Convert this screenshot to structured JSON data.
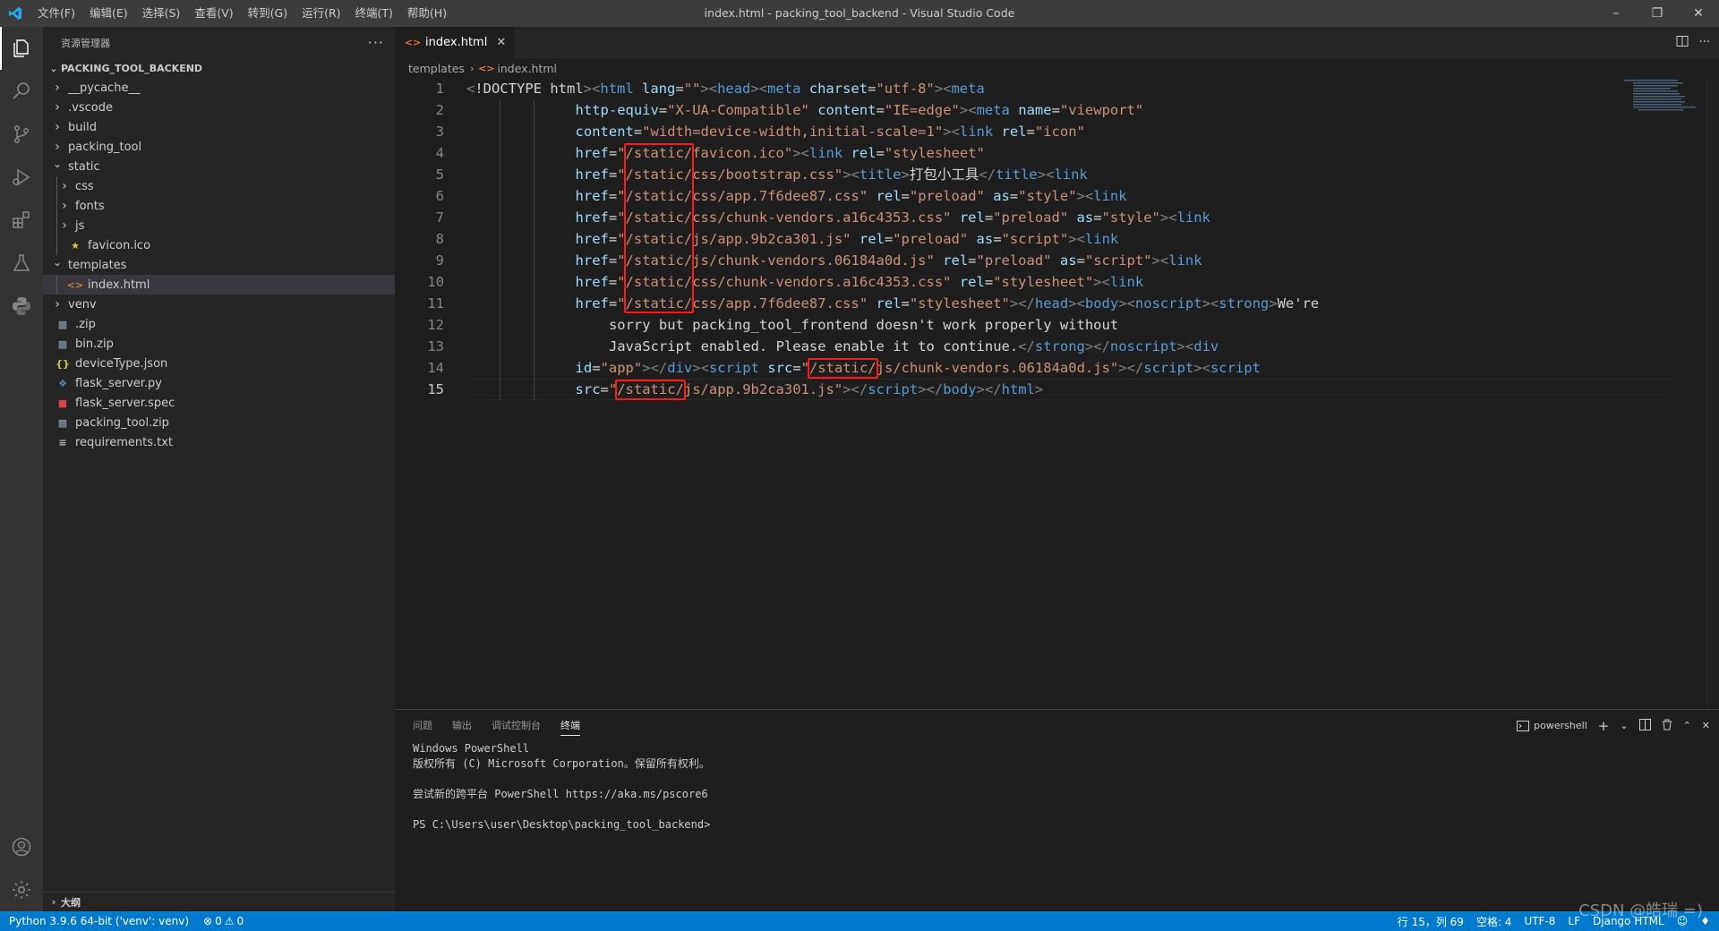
{
  "titlebar": {
    "menu": [
      "文件(F)",
      "编辑(E)",
      "选择(S)",
      "查看(V)",
      "转到(G)",
      "运行(R)",
      "终端(T)",
      "帮助(H)"
    ],
    "title": "index.html - packing_tool_backend - Visual Studio Code"
  },
  "activitybar": {
    "items": [
      "explorer-icon",
      "search-icon",
      "source-control-icon",
      "run-debug-icon",
      "extensions-icon",
      "testing-icon",
      "python-icon"
    ],
    "bottom": [
      "account-icon",
      "settings-gear-icon"
    ]
  },
  "sidebar": {
    "header": "资源管理器",
    "section": "PACKING_TOOL_BACKEND",
    "tree": [
      {
        "label": "__pycache__",
        "type": "folder",
        "depth": 1,
        "open": false
      },
      {
        "label": ".vscode",
        "type": "folder",
        "depth": 1,
        "open": false
      },
      {
        "label": "build",
        "type": "folder",
        "depth": 1,
        "open": false
      },
      {
        "label": "packing_tool",
        "type": "folder",
        "depth": 1,
        "open": false
      },
      {
        "label": "static",
        "type": "folder",
        "depth": 1,
        "open": true
      },
      {
        "label": "css",
        "type": "folder",
        "depth": 2,
        "open": false
      },
      {
        "label": "fonts",
        "type": "folder",
        "depth": 2,
        "open": false
      },
      {
        "label": "js",
        "type": "folder",
        "depth": 2,
        "open": false
      },
      {
        "label": "favicon.ico",
        "type": "file",
        "depth": 2,
        "icon": "star"
      },
      {
        "label": "templates",
        "type": "folder",
        "depth": 1,
        "open": true
      },
      {
        "label": "index.html",
        "type": "file",
        "depth": 2,
        "icon": "html",
        "selected": true
      },
      {
        "label": "venv",
        "type": "folder",
        "depth": 1,
        "open": false
      },
      {
        "label": ".zip",
        "type": "file",
        "depth": 1,
        "icon": "zip"
      },
      {
        "label": "bin.zip",
        "type": "file",
        "depth": 1,
        "icon": "zip"
      },
      {
        "label": "deviceType.json",
        "type": "file",
        "depth": 1,
        "icon": "json"
      },
      {
        "label": "flask_server.py",
        "type": "file",
        "depth": 1,
        "icon": "python"
      },
      {
        "label": "flask_server.spec",
        "type": "file",
        "depth": 1,
        "icon": "spec"
      },
      {
        "label": "packing_tool.zip",
        "type": "file",
        "depth": 1,
        "icon": "zip"
      },
      {
        "label": "requirements.txt",
        "type": "file",
        "depth": 1,
        "icon": "text"
      }
    ],
    "outline": "大纲"
  },
  "editor": {
    "tab": "index.html",
    "breadcrumb": [
      "templates",
      "index.html"
    ],
    "line_numbers": [
      "1",
      "2",
      "3",
      "4",
      "5",
      "6",
      "7",
      "8",
      "9",
      "10",
      "11",
      "12",
      "13",
      "14",
      "15"
    ],
    "current_line": 15,
    "lines": [
      [
        [
          "punc",
          "<"
        ],
        [
          "txt",
          "!DOCTYPE html"
        ],
        [
          "punc",
          ">"
        ],
        [
          "punc",
          "<"
        ],
        [
          "tag",
          "html"
        ],
        [
          "txt",
          " "
        ],
        [
          "attr",
          "lang"
        ],
        [
          "txt",
          "="
        ],
        [
          "str",
          "\"\""
        ],
        [
          "punc",
          ">"
        ],
        [
          "punc",
          "<"
        ],
        [
          "tag",
          "head"
        ],
        [
          "punc",
          ">"
        ],
        [
          "punc",
          "<"
        ],
        [
          "tag",
          "meta"
        ],
        [
          "txt",
          " "
        ],
        [
          "attr",
          "charset"
        ],
        [
          "txt",
          "="
        ],
        [
          "str",
          "\"utf-8\""
        ],
        [
          "punc",
          ">"
        ],
        [
          "punc",
          "<"
        ],
        [
          "tag",
          "meta"
        ]
      ],
      [
        [
          "attr",
          "http-equiv"
        ],
        [
          "txt",
          "="
        ],
        [
          "str",
          "\"X-UA-Compatible\""
        ],
        [
          "txt",
          " "
        ],
        [
          "attr",
          "content"
        ],
        [
          "txt",
          "="
        ],
        [
          "str",
          "\"IE=edge\""
        ],
        [
          "punc",
          ">"
        ],
        [
          "punc",
          "<"
        ],
        [
          "tag",
          "meta"
        ],
        [
          "txt",
          " "
        ],
        [
          "attr",
          "name"
        ],
        [
          "txt",
          "="
        ],
        [
          "str",
          "\"viewport\""
        ]
      ],
      [
        [
          "attr",
          "content"
        ],
        [
          "txt",
          "="
        ],
        [
          "str",
          "\"width=device-width,initial-scale=1\""
        ],
        [
          "punc",
          ">"
        ],
        [
          "punc",
          "<"
        ],
        [
          "tag",
          "link"
        ],
        [
          "txt",
          " "
        ],
        [
          "attr",
          "rel"
        ],
        [
          "txt",
          "="
        ],
        [
          "str",
          "\"icon\""
        ]
      ],
      [
        [
          "attr",
          "href"
        ],
        [
          "txt",
          "="
        ],
        [
          "str",
          "\"/static/favicon.ico\""
        ],
        [
          "punc",
          ">"
        ],
        [
          "punc",
          "<"
        ],
        [
          "tag",
          "link"
        ],
        [
          "txt",
          " "
        ],
        [
          "attr",
          "rel"
        ],
        [
          "txt",
          "="
        ],
        [
          "str",
          "\"stylesheet\""
        ]
      ],
      [
        [
          "attr",
          "href"
        ],
        [
          "txt",
          "="
        ],
        [
          "str",
          "\"/static/css/bootstrap.css\""
        ],
        [
          "punc",
          ">"
        ],
        [
          "punc",
          "<"
        ],
        [
          "tag",
          "title"
        ],
        [
          "punc",
          ">"
        ],
        [
          "txt",
          "打包小工具"
        ],
        [
          "punc",
          "</"
        ],
        [
          "tag",
          "title"
        ],
        [
          "punc",
          ">"
        ],
        [
          "punc",
          "<"
        ],
        [
          "tag",
          "link"
        ]
      ],
      [
        [
          "attr",
          "href"
        ],
        [
          "txt",
          "="
        ],
        [
          "str",
          "\"/static/css/app.7f6dee87.css\""
        ],
        [
          "txt",
          " "
        ],
        [
          "attr",
          "rel"
        ],
        [
          "txt",
          "="
        ],
        [
          "str",
          "\"preload\""
        ],
        [
          "txt",
          " "
        ],
        [
          "attr",
          "as"
        ],
        [
          "txt",
          "="
        ],
        [
          "str",
          "\"style\""
        ],
        [
          "punc",
          ">"
        ],
        [
          "punc",
          "<"
        ],
        [
          "tag",
          "link"
        ]
      ],
      [
        [
          "attr",
          "href"
        ],
        [
          "txt",
          "="
        ],
        [
          "str",
          "\"/static/css/chunk-vendors.a16c4353.css\""
        ],
        [
          "txt",
          " "
        ],
        [
          "attr",
          "rel"
        ],
        [
          "txt",
          "="
        ],
        [
          "str",
          "\"preload\""
        ],
        [
          "txt",
          " "
        ],
        [
          "attr",
          "as"
        ],
        [
          "txt",
          "="
        ],
        [
          "str",
          "\"style\""
        ],
        [
          "punc",
          ">"
        ],
        [
          "punc",
          "<"
        ],
        [
          "tag",
          "link"
        ]
      ],
      [
        [
          "attr",
          "href"
        ],
        [
          "txt",
          "="
        ],
        [
          "str",
          "\"/static/js/app.9b2ca301.js\""
        ],
        [
          "txt",
          " "
        ],
        [
          "attr",
          "rel"
        ],
        [
          "txt",
          "="
        ],
        [
          "str",
          "\"preload\""
        ],
        [
          "txt",
          " "
        ],
        [
          "attr",
          "as"
        ],
        [
          "txt",
          "="
        ],
        [
          "str",
          "\"script\""
        ],
        [
          "punc",
          ">"
        ],
        [
          "punc",
          "<"
        ],
        [
          "tag",
          "link"
        ]
      ],
      [
        [
          "attr",
          "href"
        ],
        [
          "txt",
          "="
        ],
        [
          "str",
          "\"/static/js/chunk-vendors.06184a0d.js\""
        ],
        [
          "txt",
          " "
        ],
        [
          "attr",
          "rel"
        ],
        [
          "txt",
          "="
        ],
        [
          "str",
          "\"preload\""
        ],
        [
          "txt",
          " "
        ],
        [
          "attr",
          "as"
        ],
        [
          "txt",
          "="
        ],
        [
          "str",
          "\"script\""
        ],
        [
          "punc",
          ">"
        ],
        [
          "punc",
          "<"
        ],
        [
          "tag",
          "link"
        ]
      ],
      [
        [
          "attr",
          "href"
        ],
        [
          "txt",
          "="
        ],
        [
          "str",
          "\"/static/css/chunk-vendors.a16c4353.css\""
        ],
        [
          "txt",
          " "
        ],
        [
          "attr",
          "rel"
        ],
        [
          "txt",
          "="
        ],
        [
          "str",
          "\"stylesheet\""
        ],
        [
          "punc",
          ">"
        ],
        [
          "punc",
          "<"
        ],
        [
          "tag",
          "link"
        ]
      ],
      [
        [
          "attr",
          "href"
        ],
        [
          "txt",
          "="
        ],
        [
          "str",
          "\"/static/css/app.7f6dee87.css\""
        ],
        [
          "txt",
          " "
        ],
        [
          "attr",
          "rel"
        ],
        [
          "txt",
          "="
        ],
        [
          "str",
          "\"stylesheet\""
        ],
        [
          "punc",
          ">"
        ],
        [
          "punc",
          "</"
        ],
        [
          "tag",
          "head"
        ],
        [
          "punc",
          ">"
        ],
        [
          "punc",
          "<"
        ],
        [
          "tag",
          "body"
        ],
        [
          "punc",
          ">"
        ],
        [
          "punc",
          "<"
        ],
        [
          "tag",
          "noscript"
        ],
        [
          "punc",
          ">"
        ],
        [
          "punc",
          "<"
        ],
        [
          "tag",
          "strong"
        ],
        [
          "punc",
          ">"
        ],
        [
          "txt",
          "We're"
        ]
      ],
      [
        [
          "txt",
          "sorry but packing_tool_frontend doesn't work properly without"
        ]
      ],
      [
        [
          "txt",
          "JavaScript enabled. Please enable it to continue."
        ],
        [
          "punc",
          "</"
        ],
        [
          "tag",
          "strong"
        ],
        [
          "punc",
          ">"
        ],
        [
          "punc",
          "</"
        ],
        [
          "tag",
          "noscript"
        ],
        [
          "punc",
          ">"
        ],
        [
          "punc",
          "<"
        ],
        [
          "tag",
          "div"
        ]
      ],
      [
        [
          "attr",
          "id"
        ],
        [
          "txt",
          "="
        ],
        [
          "str",
          "\"app\""
        ],
        [
          "punc",
          ">"
        ],
        [
          "punc",
          "</"
        ],
        [
          "tag",
          "div"
        ],
        [
          "punc",
          ">"
        ],
        [
          "punc",
          "<"
        ],
        [
          "tag",
          "script"
        ],
        [
          "txt",
          " "
        ],
        [
          "attr",
          "src"
        ],
        [
          "txt",
          "="
        ],
        [
          "str",
          "\"/static/js/chunk-vendors.06184a0d.js\""
        ],
        [
          "punc",
          ">"
        ],
        [
          "punc",
          "</"
        ],
        [
          "tag",
          "script"
        ],
        [
          "punc",
          ">"
        ],
        [
          "punc",
          "<"
        ],
        [
          "tag",
          "script"
        ]
      ],
      [
        [
          "attr",
          "src"
        ],
        [
          "txt",
          "="
        ],
        [
          "str",
          "\"/static/js/app.9b2ca301.js\""
        ],
        [
          "punc",
          ">"
        ],
        [
          "punc",
          "</"
        ],
        [
          "tag",
          "script"
        ],
        [
          "punc",
          ">"
        ],
        [
          "punc",
          "</"
        ],
        [
          "tag",
          "body"
        ],
        [
          "punc",
          ">"
        ],
        [
          "punc",
          "</"
        ],
        [
          "tag",
          "html"
        ],
        [
          "punc",
          ">"
        ]
      ]
    ]
  },
  "panel": {
    "tabs": [
      "问题",
      "输出",
      "调试控制台",
      "终端"
    ],
    "active_tab": "终端",
    "shell": "powershell",
    "terminal_lines": [
      "Windows PowerShell",
      "版权所有 (C) Microsoft Corporation。保留所有权利。",
      "",
      "尝试新的跨平台 PowerShell https://aka.ms/pscore6",
      "",
      "PS C:\\Users\\user\\Desktop\\packing_tool_backend>"
    ]
  },
  "statusbar": {
    "python": "Python 3.9.6 64-bit ('venv': venv)",
    "errors": "0",
    "warnings": "0",
    "position": "行 15，列 69",
    "spaces": "空格: 4",
    "encoding": "UTF-8",
    "eol": "LF",
    "language": "Django HTML"
  },
  "watermark": "CSDN @皓瑞 =)",
  "colors": {
    "accent": "#007acc",
    "highlight_box": "#ff1a1a",
    "tag": "#569cd6",
    "attr": "#9cdcfe",
    "string": "#ce9178"
  }
}
